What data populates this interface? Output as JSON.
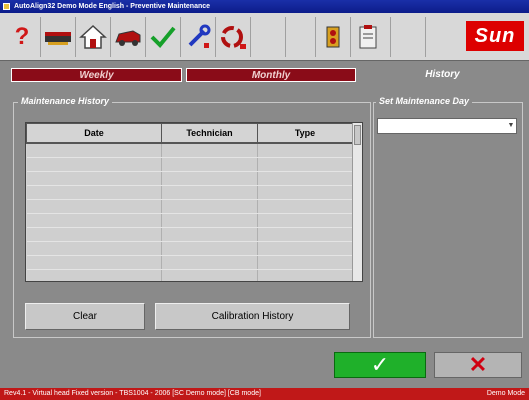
{
  "window": {
    "title": "AutoAlign32  Demo Mode  English  - Preventive Maintenance"
  },
  "toolbar": {
    "icons": [
      "help-icon",
      "vehicle-icon",
      "home-icon",
      "car-icon",
      "checkmark-icon",
      "wrench-icon",
      "rotate-icon",
      "sensor-icon",
      "clipboard-icon"
    ],
    "brand": "Sun",
    "colors": {
      "accent_red": "#d00000"
    }
  },
  "tabs": [
    {
      "label": "Weekly"
    },
    {
      "label": "Monthly"
    },
    {
      "label": "History"
    }
  ],
  "history_panel": {
    "title": "Maintenance History",
    "columns": [
      "Date",
      "Technician",
      "Type"
    ],
    "rows": []
  },
  "day_panel": {
    "title": "Set Maintenance Day",
    "selected_value": ""
  },
  "buttons": {
    "clear": "Clear",
    "calibration_history": "Calibration History",
    "ok_symbol": "✓",
    "cancel_symbol": "✕"
  },
  "status": {
    "text": "Rev4.1 - Virtual head   Fixed version - TBS1004 - 2006   [SC Demo mode]   [CB mode]",
    "mode": "Demo Mode"
  }
}
